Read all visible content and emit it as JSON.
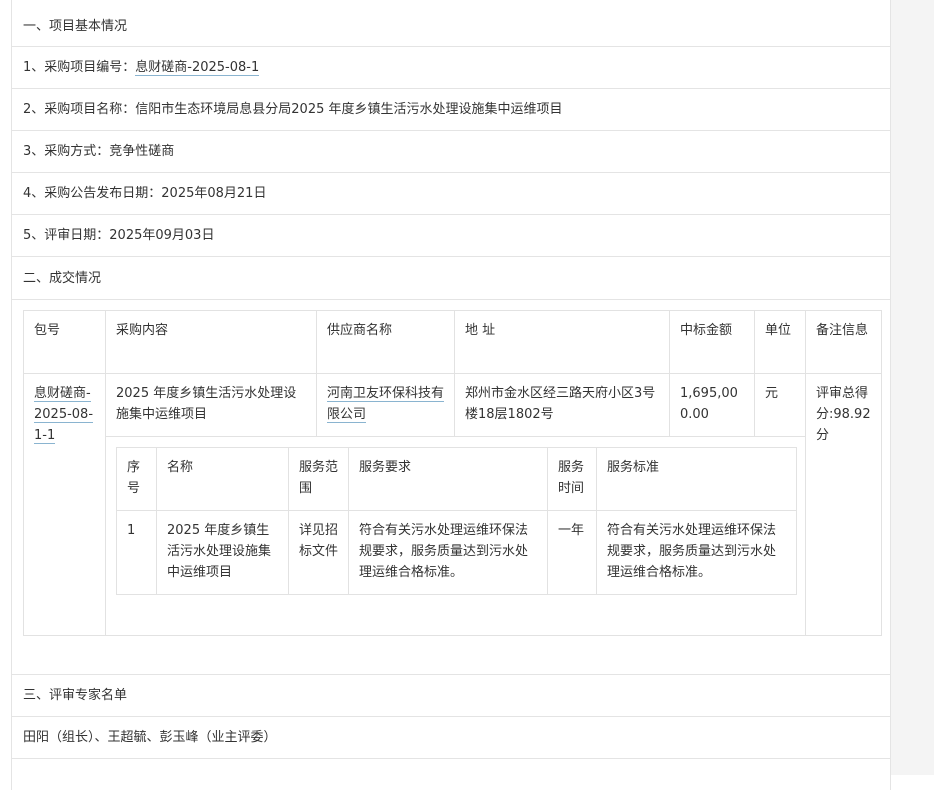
{
  "rows": {
    "section1_title": "一、项目基本情况",
    "item1_label": "1、采购项目编号：",
    "item1_value": "息财磋商-2025-08-1",
    "item2_label": "2、采购项目名称：",
    "item2_value": "信阳市生态环境局息县分局2025 年度乡镇生活污水处理设施集中运维项目",
    "item3_label": "3、采购方式：",
    "item3_value": "竞争性磋商",
    "item4_label": "4、采购公告发布日期：",
    "item4_value": "2025年08月21日",
    "item5_label": "5、评审日期：",
    "item5_value": "2025年09月03日",
    "section2_title": "二、成交情况",
    "section3_title": "三、评审专家名单",
    "experts": "田阳（组长）、王超毓、彭玉峰（业主评委）"
  },
  "deal_table": {
    "headers": [
      "包号",
      "采购内容",
      "供应商名称",
      "地 址",
      "中标金额",
      "单位",
      "备注信息"
    ],
    "row": {
      "package": "息财磋商-2025-08-1-1",
      "content": "2025 年度乡镇生活污水处理设施集中运维项目",
      "supplier": "河南卫友环保科技有限公司",
      "address": "郑州市金水区经三路天府小区3号楼18层1802号",
      "amount": "1,695,000.00",
      "unit": "元",
      "remark": "评审总得分:98.92分"
    }
  },
  "service_table": {
    "headers": [
      "序号",
      "名称",
      "服务范围",
      "服务要求",
      "服务时间",
      "服务标准"
    ],
    "row": {
      "no": "1",
      "name": "2025 年度乡镇生活污水处理设施集中运维项目",
      "scope": "详见招标文件",
      "requirement": "符合有关污水处理运维环保法规要求，服务质量达到污水处理运维合格标准。",
      "time": "一年",
      "standard": "符合有关污水处理运维环保法规要求，服务质量达到污水处理运维合格标准。"
    }
  }
}
